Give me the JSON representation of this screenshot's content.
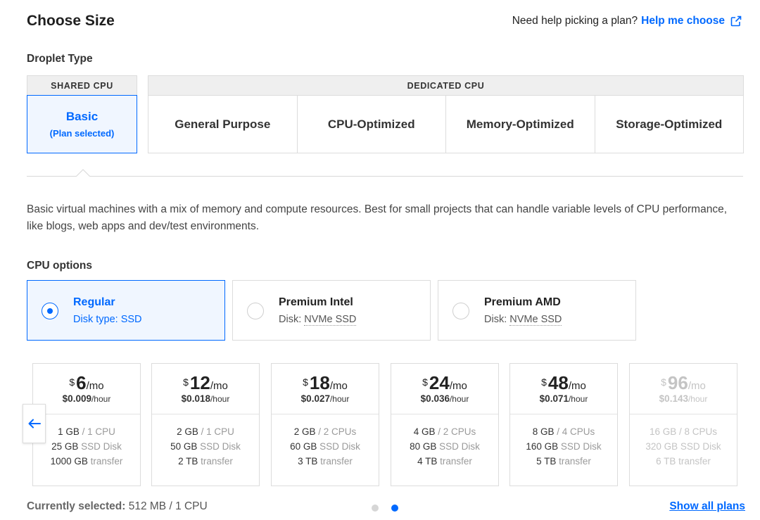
{
  "header": {
    "title": "Choose Size",
    "help_question": "Need help picking a plan?",
    "help_link": "Help me choose",
    "help_icon": "external-link-icon"
  },
  "droplet_type": {
    "label": "Droplet Type",
    "shared_header": "SHARED CPU",
    "dedicated_header": "DEDICATED CPU",
    "basic": {
      "title": "Basic",
      "subtitle": "(Plan selected)"
    },
    "dedicated_options": [
      "General Purpose",
      "CPU-Optimized",
      "Memory-Optimized",
      "Storage-Optimized"
    ]
  },
  "description": "Basic virtual machines with a mix of memory and compute resources. Best for small projects that can handle variable levels of CPU performance, like blogs, web apps and dev/test environments.",
  "cpu_options": {
    "label": "CPU options",
    "items": [
      {
        "name": "Regular",
        "disk_prefix": "Disk type: ",
        "disk_value": "SSD",
        "selected": true
      },
      {
        "name": "Premium Intel",
        "disk_prefix": "Disk: ",
        "disk_value": "NVMe SSD",
        "selected": false
      },
      {
        "name": "Premium AMD",
        "disk_prefix": "Disk: ",
        "disk_value": "NVMe SSD",
        "selected": false
      }
    ]
  },
  "plans": [
    {
      "currency": "$",
      "price": "6",
      "per": "/mo",
      "hourly": "$0.009",
      "hour_unit": "/hour",
      "mem": "1 GB",
      "cpu": " / 1 CPU",
      "disk": "25 GB",
      "disk_unit": " SSD Disk",
      "transfer": "1000 GB",
      "transfer_unit": " transfer",
      "disabled": false
    },
    {
      "currency": "$",
      "price": "12",
      "per": "/mo",
      "hourly": "$0.018",
      "hour_unit": "/hour",
      "mem": "2 GB",
      "cpu": " / 1 CPU",
      "disk": "50 GB",
      "disk_unit": " SSD Disk",
      "transfer": "2 TB",
      "transfer_unit": " transfer",
      "disabled": false
    },
    {
      "currency": "$",
      "price": "18",
      "per": "/mo",
      "hourly": "$0.027",
      "hour_unit": "/hour",
      "mem": "2 GB",
      "cpu": " / 2 CPUs",
      "disk": "60 GB",
      "disk_unit": " SSD Disk",
      "transfer": "3 TB",
      "transfer_unit": " transfer",
      "disabled": false
    },
    {
      "currency": "$",
      "price": "24",
      "per": "/mo",
      "hourly": "$0.036",
      "hour_unit": "/hour",
      "mem": "4 GB",
      "cpu": " / 2 CPUs",
      "disk": "80 GB",
      "disk_unit": " SSD Disk",
      "transfer": "4 TB",
      "transfer_unit": " transfer",
      "disabled": false
    },
    {
      "currency": "$",
      "price": "48",
      "per": "/mo",
      "hourly": "$0.071",
      "hour_unit": "/hour",
      "mem": "8 GB",
      "cpu": " / 4 CPUs",
      "disk": "160 GB",
      "disk_unit": " SSD Disk",
      "transfer": "5 TB",
      "transfer_unit": " transfer",
      "disabled": false
    },
    {
      "currency": "$",
      "price": "96",
      "per": "/mo",
      "hourly": "$0.143",
      "hour_unit": "/hour",
      "mem": "16 GB",
      "cpu": " / 8 CPUs",
      "disk": "320 GB",
      "disk_unit": " SSD Disk",
      "transfer": "6 TB",
      "transfer_unit": " transfer",
      "disabled": true
    }
  ],
  "footer": {
    "current_label": "Currently selected:",
    "current_value": " 512 MB / 1 CPU",
    "show_all": "Show all plans",
    "carousel_page": 2,
    "carousel_total": 2
  },
  "colors": {
    "accent": "#0069ff",
    "selected_bg": "#f0f6ff",
    "border": "#dcdcdc"
  }
}
